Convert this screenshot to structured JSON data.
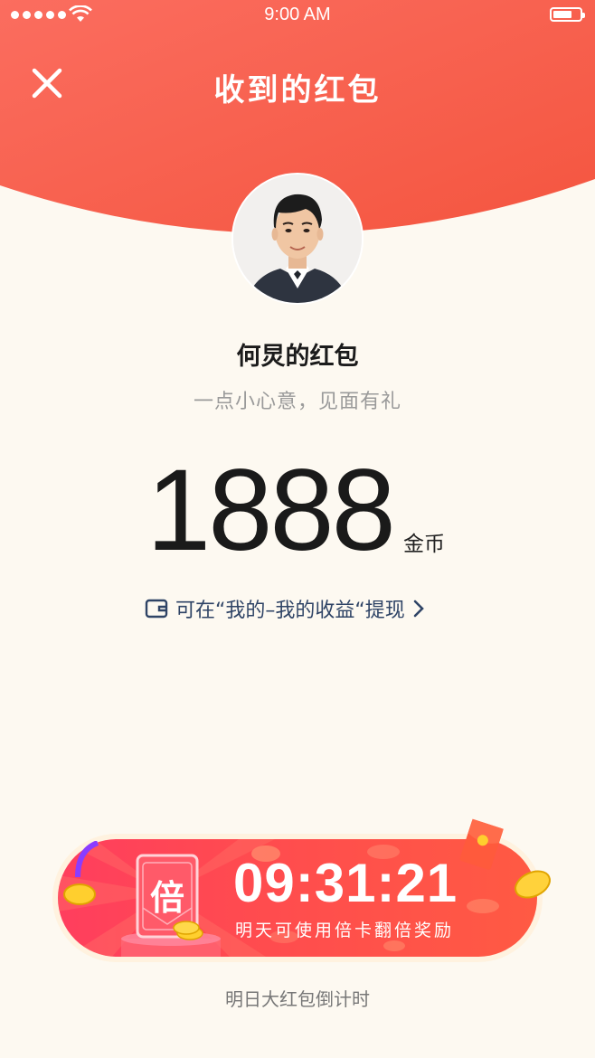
{
  "status_bar": {
    "time": "9:00 AM",
    "battery_level": 0.7
  },
  "header": {
    "title": "收到的红包",
    "close_icon": "close-icon"
  },
  "packet": {
    "sender": "何炅的红包",
    "message": "一点小心意，见面有礼",
    "amount": "1888",
    "unit": "金币",
    "withdraw_hint": "可在“我的–我的收益“提现"
  },
  "countdown": {
    "card_label": "倍",
    "timer": "09:31:21",
    "subtitle": "明天可使用倍卡翻倍奖励",
    "footer": "明日大红包倒计时"
  },
  "colors": {
    "accent": "#f65a45",
    "background": "#fdf9f1",
    "banner": "#ff4a52"
  }
}
